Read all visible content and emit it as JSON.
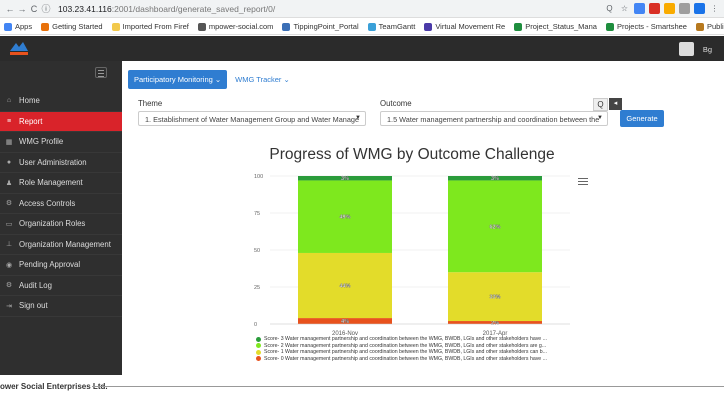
{
  "browser": {
    "url_host": "103.23.41.116",
    "url_path": ":2001/dashboard/generate_saved_report/0/",
    "bookmarks": [
      {
        "label": "Apps",
        "color": "#4285f4"
      },
      {
        "label": "Getting Started",
        "color": "#e8710a"
      },
      {
        "label": "Imported From Firef",
        "color": "#f2c94c"
      },
      {
        "label": "mpower-social.com",
        "color": "#555555"
      },
      {
        "label": "TippingPoint_Portal",
        "color": "#3b6fb6"
      },
      {
        "label": "TeamGantt",
        "color": "#3aa0d8"
      },
      {
        "label": "Virtual Movement Re",
        "color": "#4a3aa8"
      },
      {
        "label": "Project_Status_Mana",
        "color": "#1e8e3e"
      },
      {
        "label": "Projects - Smartshee",
        "color": "#1e8e3e"
      },
      {
        "label": "Public Accessibility",
        "color": "#b7791f"
      }
    ]
  },
  "header": {
    "user_label": "Bg"
  },
  "sidebar": {
    "items": [
      {
        "label": "Home",
        "icon": "home-icon",
        "glyph": "⌂",
        "active": false
      },
      {
        "label": "Report",
        "icon": "list-icon",
        "glyph": "≡",
        "active": true
      },
      {
        "label": "WMG Profile",
        "icon": "grid-icon",
        "glyph": "▦",
        "active": false
      },
      {
        "label": "User Administration",
        "icon": "user-icon",
        "glyph": "●",
        "active": false
      },
      {
        "label": "Role Management",
        "icon": "users-icon",
        "glyph": "♟",
        "active": false
      },
      {
        "label": "Access Controls",
        "icon": "gears-icon",
        "glyph": "⚙",
        "active": false
      },
      {
        "label": "Organization Roles",
        "icon": "briefcase-icon",
        "glyph": "▭",
        "active": false
      },
      {
        "label": "Organization Management",
        "icon": "sitemap-icon",
        "glyph": "⊥",
        "active": false
      },
      {
        "label": "Pending Approval",
        "icon": "eye-icon",
        "glyph": "◉",
        "active": false
      },
      {
        "label": "Audit Log",
        "icon": "gear-icon",
        "glyph": "⚙",
        "active": false
      },
      {
        "label": "Sign out",
        "icon": "sign-out-icon",
        "glyph": "⇥",
        "active": false
      }
    ]
  },
  "main": {
    "tabs": [
      {
        "label": "Participatory Monitoring ⌄",
        "active": true
      },
      {
        "label": "WMG Tracker ⌄",
        "active": false
      }
    ],
    "theme_label": "Theme",
    "theme_value": "1. Establishment of Water Management Group and Water Manage",
    "outcome_label": "Outcome",
    "outcome_value": "1.5 Water management partnership and coordination between the",
    "generate_label": "Generate",
    "search_glyph": "Q",
    "arrow_glyph": "◂"
  },
  "chart_data": {
    "type": "bar",
    "stacked": true,
    "title": "Progress of WMG by Outcome Challenge",
    "categories": [
      "2016-Nov",
      "2017-Apr"
    ],
    "ylim": [
      0,
      100
    ],
    "yticks": [
      "0",
      "25",
      "50",
      "75",
      "100"
    ],
    "series": [
      {
        "name": "Score- 0 Water management partnership and coordination between the WMG, BWDB, LGIs and other stakeholders have ...",
        "color": "#e8521d",
        "values": [
          4,
          2
        ],
        "labels": [
          "4%",
          "2%"
        ]
      },
      {
        "name": "Score- 1 Water management partnership and coordination between the WMG, BWDB, LGIs and other stakeholders can b...",
        "color": "#e3dc2a",
        "values": [
          44,
          33
        ],
        "labels": [
          "44%",
          "33%"
        ]
      },
      {
        "name": "Score- 2 Water management partnership and coordination between the WMG, BWDB, LGIs and other stakeholders are g...",
        "color": "#7ee81e",
        "values": [
          49,
          62
        ],
        "labels": [
          "49%",
          "62%"
        ]
      },
      {
        "name": "Score- 3 Water management partnership and coordination between the WMG, BWDB, LGIs and other stakeholders have ...",
        "color": "#2a9c3b",
        "values": [
          3,
          3
        ],
        "labels": [
          "3%",
          "3%"
        ]
      }
    ],
    "legend_order": [
      3,
      2,
      1,
      0
    ],
    "legend_position": "bottom"
  },
  "footer": {
    "text": "ower Social Enterprises Ltd."
  }
}
